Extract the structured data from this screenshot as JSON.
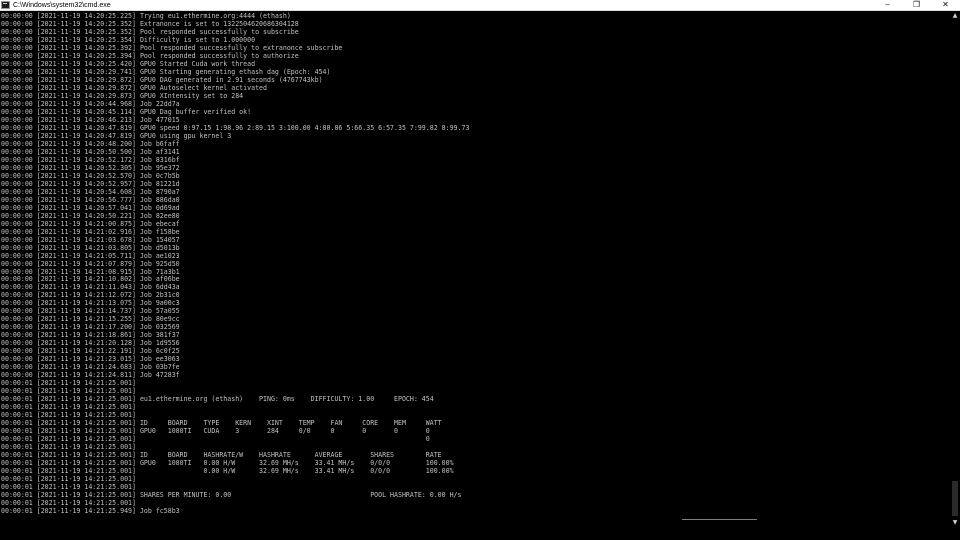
{
  "window": {
    "title": "C:\\Windows\\system32\\cmd.exe",
    "icon": "console-icon",
    "controls": {
      "minimize": "–",
      "maximize": "❐",
      "close": "✕"
    }
  },
  "console": {
    "text_color": "#c0c0c0",
    "background": "#000000",
    "lines": [
      "00:00:00 [2021-11-19 14:20:25.225] Trying eu1.ethermine.org:4444 (ethash)",
      "00:00:00 [2021-11-19 14:20:25.352] Extranonce is set to 1322504620686304128",
      "00:00:00 [2021-11-19 14:20:25.352] Pool responded successfully to subscribe",
      "00:00:00 [2021-11-19 14:20:25.354] Difficulty is set to 1.000000",
      "00:00:00 [2021-11-19 14:20:25.392] Pool responded successfully to extranonce subscribe",
      "00:00:00 [2021-11-19 14:20:25.394] Pool responded successfully to authorize",
      "00:00:00 [2021-11-19 14:20:25.420] GPU0 Started Cuda work thread",
      "00:00:00 [2021-11-19 14:20:29.741] GPU0 Starting generating ethash dag (Epoch: 454)",
      "00:00:00 [2021-11-19 14:20:29.872] GPU0 DAG generated in 2.91 seconds (4767743kb)",
      "00:00:00 [2021-11-19 14:20:29.872] GPU0 Autoselect kernel activated",
      "00:00:00 [2021-11-19 14:20:29.873] GPU0 XIntensity set to 284",
      "00:00:00 [2021-11-19 14:20:44.968] Job 22dd7a",
      "00:00:00 [2021-11-19 14:20:45.114] GPU0 Dag buffer verified ok!",
      "00:00:00 [2021-11-19 14:20:46.213] Job 477015",
      "00:00:00 [2021-11-19 14:20:47.819] GPU0 speed 0:97.15 1:98.96 2:89.15 3:100.00 4:80.06 5:66.35 6:57.35 7:99.82 8:99.73",
      "00:00:00 [2021-11-19 14:20:47.819] GPU0 using gpu kernel 3",
      "00:00:00 [2021-11-19 14:20:48.200] Job b6faff",
      "00:00:00 [2021-11-19 14:20:50.500] Job af3141",
      "00:00:00 [2021-11-19 14:20:52.172] Job 8316bf",
      "00:00:00 [2021-11-19 14:20:52.305] Job 95e372",
      "00:00:00 [2021-11-19 14:20:52.570] Job 0c7b5b",
      "00:00:00 [2021-11-19 14:20:52.957] Job 81221d",
      "00:00:00 [2021-11-19 14:20:54.608] Job 8790a7",
      "00:00:00 [2021-11-19 14:20:56.777] Job 886da0",
      "00:00:00 [2021-11-19 14:20:57.041] Job 0d69ad",
      "00:00:00 [2021-11-19 14:20:50.221] Job 82ee80",
      "00:00:00 [2021-11-19 14:21:00.875] Job ebecaf",
      "00:00:00 [2021-11-19 14:21:02.916] Job f158be",
      "00:00:00 [2021-11-19 14:21:03.678] Job 154057",
      "00:00:00 [2021-11-19 14:21:03.805] Job d5013b",
      "00:00:00 [2021-11-19 14:21:05.711] Job ae1023",
      "00:00:00 [2021-11-19 14:21:07.879] Job 925d50",
      "00:00:00 [2021-11-19 14:21:08.915] Job 71a3b1",
      "00:00:00 [2021-11-19 14:21:10.802] Job af06be",
      "00:00:00 [2021-11-19 14:21:11.043] Job 6dd43a",
      "00:00:00 [2021-11-19 14:21:12.072] Job 2b31c0",
      "00:00:00 [2021-11-19 14:21:13.075] Job 9a00c3",
      "00:00:00 [2021-11-19 14:21:14.737] Job 57a055",
      "00:00:00 [2021-11-19 14:21:15.255] Job 80e9cc",
      "00:00:00 [2021-11-19 14:21:17.200] Job 032569",
      "00:00:00 [2021-11-19 14:21:18.861] Job 381f37",
      "00:00:00 [2021-11-19 14:21:20.128] Job 1d9556",
      "00:00:00 [2021-11-19 14:21:22.191] Job 6c0f25",
      "00:00:00 [2021-11-19 14:21:23.015] Job ee3063",
      "00:00:00 [2021-11-19 14:21:24.683] Job 03b7fe",
      "00:00:00 [2021-11-19 14:21:24.811] Job 47283f",
      "00:00:01 [2021-11-19 14:21:25.001]",
      "00:00:01 [2021-11-19 14:21:25.001]",
      "00:00:01 [2021-11-19 14:21:25.001] eu1.ethermine.org (ethash)    PING: 0ms    DIFFICULTY: 1.00     EPOCH: 454",
      "00:00:01 [2021-11-19 14:21:25.001]",
      "00:00:01 [2021-11-19 14:21:25.001]",
      "00:00:01 [2021-11-19 14:21:25.001] ID     BOARD    TYPE    KERN    XINT    TEMP    FAN     CORE    MEM     WATT",
      "00:00:01 [2021-11-19 14:21:25.001] GPU0   1080TI   CUDA    3       284     0/0     0       0       0       0",
      "00:00:01 [2021-11-19 14:21:25.001]                                                                         0",
      "00:00:01 [2021-11-19 14:21:25.001]",
      "00:00:01 [2021-11-19 14:21:25.001] ID     BOARD    HASHRATE/W    HASHRATE      AVERAGE       SHARES        RATE",
      "00:00:01 [2021-11-19 14:21:25.001] GPU0   1080TI   0.00 H/W      32.69 MH/s    33.41 MH/s    0/0/0         100.00%",
      "00:00:01 [2021-11-19 14:21:25.001]                 0.00 H/W      32.69 MH/s    33.41 MH/s    0/0/0         100.00%",
      "00:00:01 [2021-11-19 14:21:25.001]",
      "00:00:01 [2021-11-19 14:21:25.001]",
      "00:00:01 [2021-11-19 14:21:25.001] SHARES PER MINUTE: 0.00                                   POOL HASHRATE: 0.00 H/s",
      "00:00:01 [2021-11-19 14:21:25.001]",
      "00:00:01 [2021-11-19 14:21:25.949] Job fc58b3"
    ]
  },
  "scrollbar": {
    "up_arrow": "▲",
    "down_arrow": "▼"
  }
}
